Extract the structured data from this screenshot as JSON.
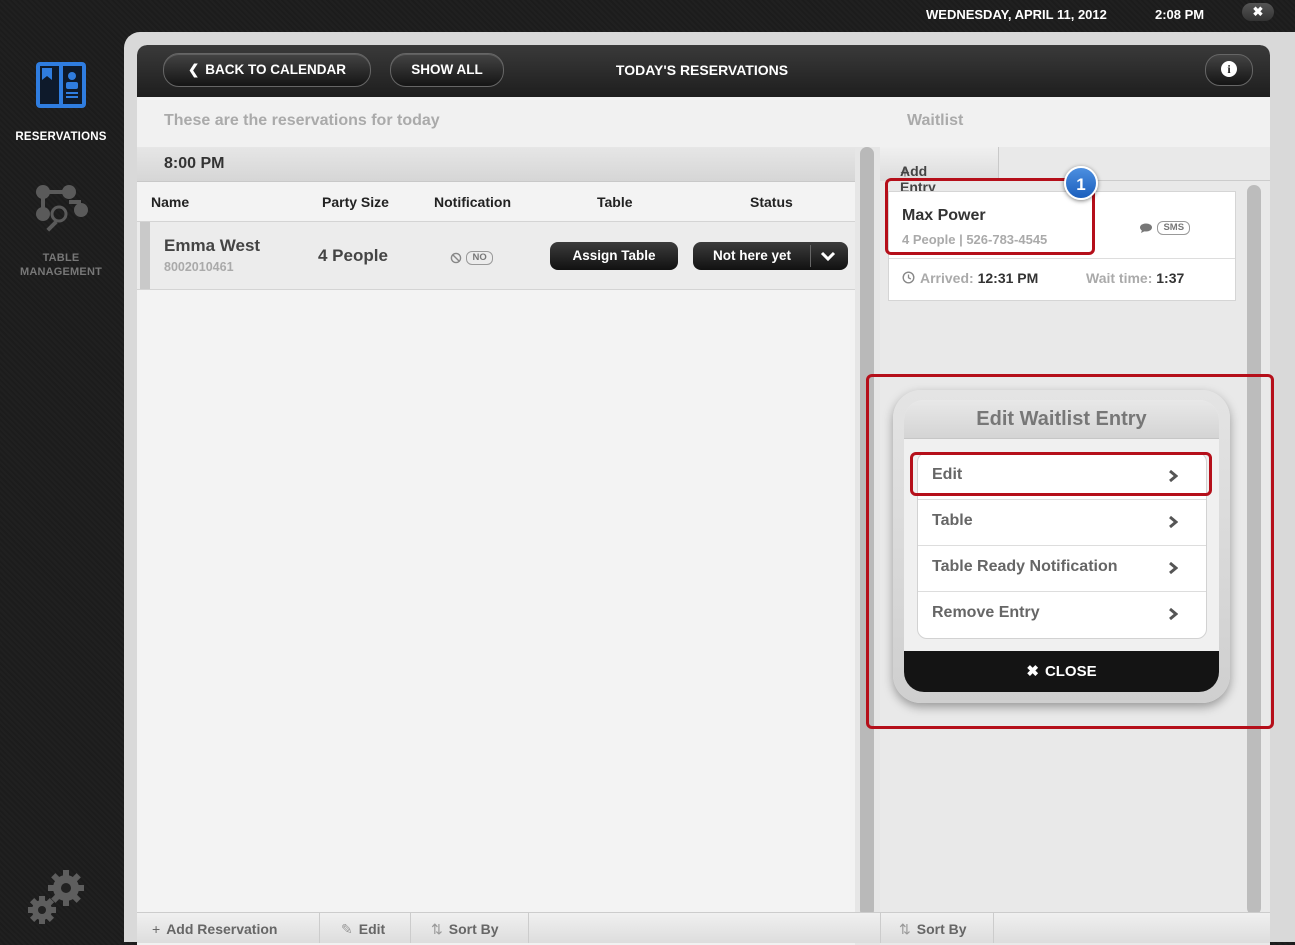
{
  "topbar": {
    "date": "WEDNESDAY, APRIL 11, 2012",
    "time": "2:08 PM",
    "close_glyph": "✖"
  },
  "nav": {
    "reservations_label": "RESERVATIONS",
    "table_management_line1": "TABLE",
    "table_management_line2": "MANAGEMENT"
  },
  "header": {
    "back_label": "BACK TO CALENDAR",
    "show_all_label": "SHOW ALL",
    "title": "TODAY'S RESERVATIONS",
    "info_glyph": "i"
  },
  "reservations": {
    "subtitle": "These are the reservations for today",
    "time_slot": "8:00 PM",
    "columns": [
      "Name",
      "Party Size",
      "Notification",
      "Table",
      "Status"
    ],
    "rows": [
      {
        "name": "Emma West",
        "id": "8002010461",
        "party": "4 People",
        "notification": "NO",
        "table_button": "Assign Table",
        "status": "Not here yet"
      }
    ]
  },
  "waitlist": {
    "subtitle": "Waitlist",
    "add_entry": "Add Entry",
    "entries": [
      {
        "name": "Max Power",
        "details": "4 People | 526-783-4545",
        "notification": "SMS",
        "arrived_label": "Arrived:",
        "arrived_time": "12:31 PM",
        "wait_label": "Wait time:",
        "wait_time": "1:37"
      }
    ]
  },
  "popup": {
    "title": "Edit Waitlist Entry",
    "items": [
      "Edit",
      "Table",
      "Table Ready Notification",
      "Remove Entry"
    ],
    "close_label": "CLOSE",
    "close_glyph": "✖"
  },
  "toolbar": {
    "add_reservation": "Add Reservation",
    "edit": "Edit",
    "sort_by": "Sort By",
    "waitlist_sort_by": "Sort By"
  },
  "annotation": {
    "step_number": "1",
    "highlight_color": "#b50f1a",
    "badge_color": "#2f74d0"
  },
  "colors": {
    "header_dark": "#1e1e1e",
    "sidebar_accent": "#3b8ee8"
  }
}
